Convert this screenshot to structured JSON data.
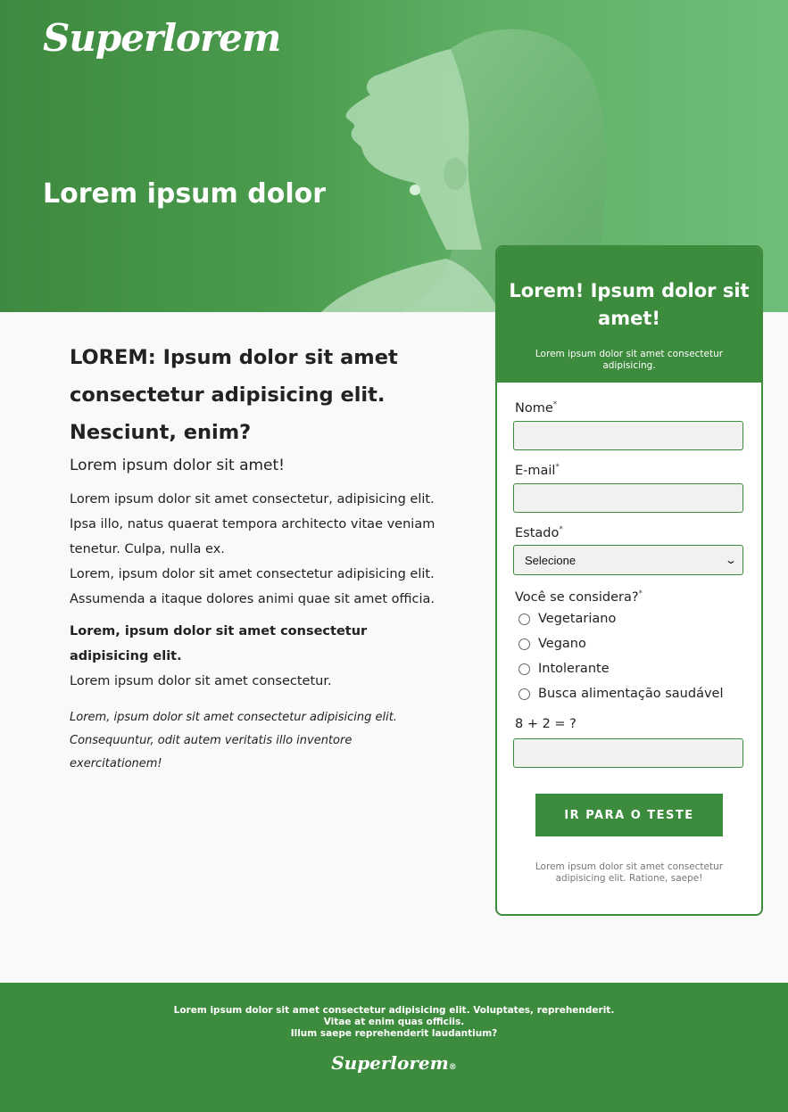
{
  "hero": {
    "logo": "Superlorem",
    "title": "Lorem ipsum dolor",
    "photo": "woman-profile-photo"
  },
  "content": {
    "heading": "LOREM: Ipsum dolor sit amet consectetur adipisicing elit. Nesciunt, enim?",
    "subheading": "Lorem ipsum dolor sit amet!",
    "paragraph1": "Lorem ipsum dolor sit amet consectetur, adipisicing elit. Ipsa illo, natus quaerat tempora architecto vitae veniam tenetur. Culpa, nulla ex.",
    "paragraph2": "Lorem, ipsum dolor sit amet consectetur adipisicing elit. Assumenda a itaque dolores animi quae sit amet officia.",
    "bold_text": "Lorem, ipsum dolor sit amet consectetur adipisicing elit.",
    "paragraph3": "Lorem ipsum dolor sit amet consectetur.",
    "italic_text": "Lorem, ipsum dolor sit amet consectetur adipisicing elit. Consequuntur, odit autem veritatis illo inventore exercitationem!"
  },
  "form": {
    "title": "Lorem! Ipsum dolor sit amet!",
    "subtitle": "Lorem ipsum dolor sit amet consectetur adipisicing.",
    "required_mark": "*",
    "nome_label": "Nome",
    "nome_value": "",
    "email_label": "E-mail",
    "email_value": "",
    "estado_label": "Estado",
    "estado_selected": "Selecione",
    "considera_label": "Você se considera?",
    "options": [
      "Vegetariano",
      "Vegano",
      "Intolerante",
      "Busca alimentação saudável"
    ],
    "captcha_label": "8 + 2 = ?",
    "captcha_value": "",
    "submit_label": "IR PARA O TESTE",
    "footnote": "Lorem ipsum dolor sit amet consectetur adipisicing elit. Ratione, saepe!"
  },
  "footer": {
    "line1": "Lorem ipsum dolor sit amet consectetur adipisicing elit. Voluptates, reprehenderit.",
    "line2": "Vitae at enim quas officiis.",
    "line3": "Illum saepe reprehenderit laudantium?",
    "logo": "Superlorem",
    "registered": "®"
  },
  "colors": {
    "brand_green": "#3d8b3d",
    "page_bg": "#f9f9f9",
    "input_bg": "#f1f1f1"
  }
}
